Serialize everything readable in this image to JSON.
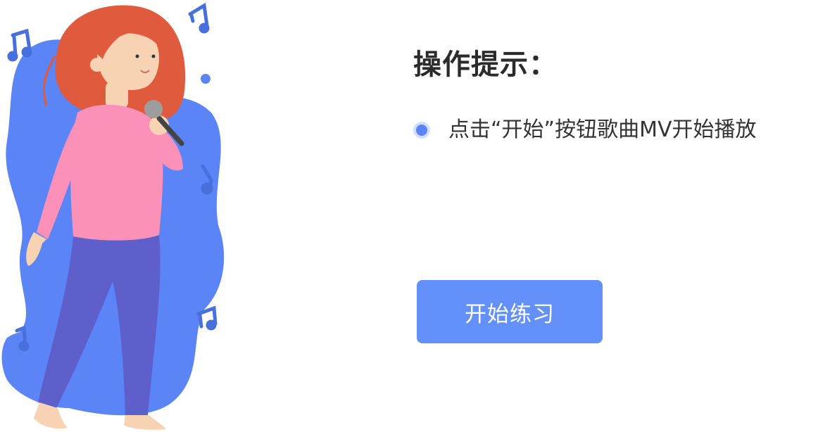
{
  "tips": {
    "title": "操作提示：",
    "items": [
      {
        "text": "点击“开始”按钮歌曲MV开始播放"
      }
    ]
  },
  "actions": {
    "start_label": "开始练习"
  },
  "colors": {
    "accent": "#6490fa",
    "bullet": "#5b84f6",
    "bullet_ring": "#d3deff",
    "blob": "#5b84f6",
    "hair": "#e05a3e",
    "shirt": "#fb90b9",
    "pants": "#5f5fcc",
    "skin": "#f8d3b3"
  },
  "illustration": {
    "subject": "girl-singing-with-microphone",
    "decorations": [
      "music-note-icon",
      "music-note-icon",
      "music-note-icon",
      "music-note-icon",
      "music-note-icon"
    ]
  }
}
